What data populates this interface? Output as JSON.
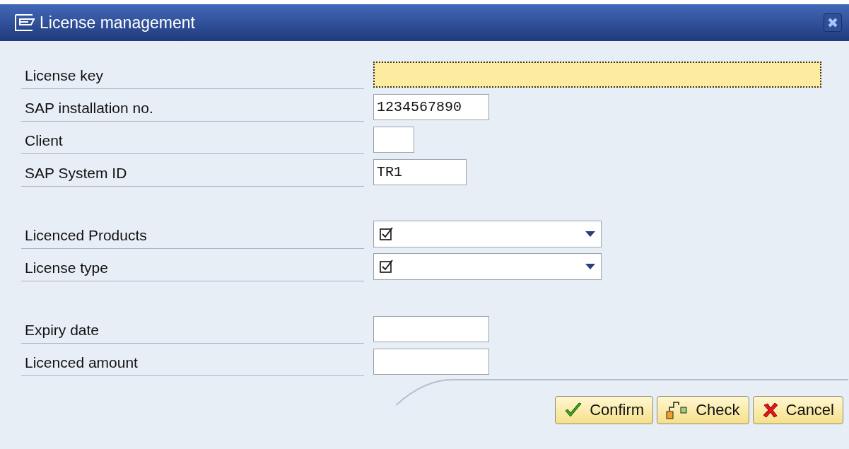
{
  "window": {
    "title": "License management"
  },
  "groups": [
    {
      "rows": [
        {
          "kind": "text",
          "label": "License key",
          "value": "",
          "focused": true
        },
        {
          "kind": "text",
          "label": "SAP installation no.",
          "value": "1234567890",
          "focused": false
        },
        {
          "kind": "text",
          "label": "Client",
          "value": "",
          "focused": false
        },
        {
          "kind": "text",
          "label": "SAP System ID",
          "value": "TR1",
          "focused": false
        }
      ]
    },
    {
      "rows": [
        {
          "kind": "dropdown",
          "label": "Licenced Products",
          "checked": true
        },
        {
          "kind": "dropdown",
          "label": "License type",
          "checked": true
        }
      ]
    },
    {
      "rows": [
        {
          "kind": "text",
          "label": "Expiry date",
          "value": "",
          "focused": false
        },
        {
          "kind": "text",
          "label": "Licenced amount",
          "value": "",
          "focused": false
        }
      ]
    }
  ],
  "buttons": [
    {
      "kind": "confirm",
      "label": "Confirm"
    },
    {
      "kind": "check",
      "label": "Check"
    },
    {
      "kind": "cancel",
      "label": "Cancel"
    }
  ]
}
